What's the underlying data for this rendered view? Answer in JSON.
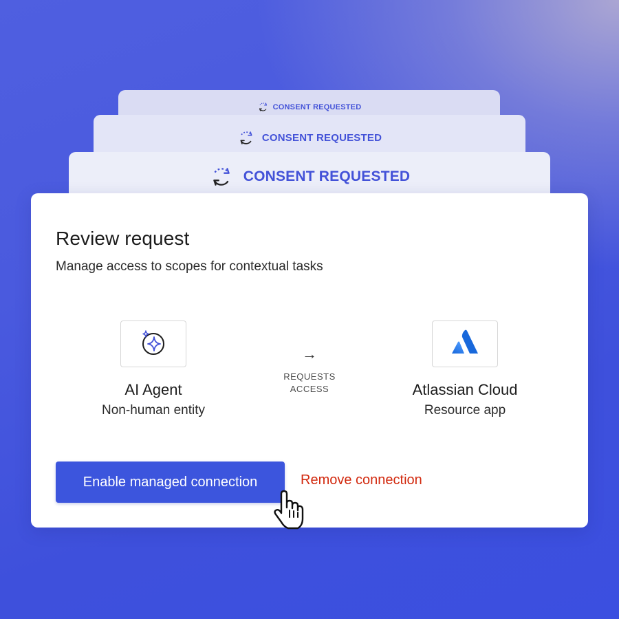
{
  "stack": {
    "back_label": "CONSENT REQUESTED",
    "mid_label": "CONSENT REQUESTED",
    "front_label": "CONSENT REQUESTED",
    "icon": "refresh-cycle-icon"
  },
  "review": {
    "title": "Review request",
    "subtitle": "Manage access to scopes for contextual tasks"
  },
  "agent": {
    "icon": "ai-sparkle-icon",
    "name": "AI Agent",
    "description": "Non-human entity"
  },
  "relation": {
    "arrow": "→",
    "label": "REQUESTS\nACCESS"
  },
  "resource": {
    "icon": "atlassian-logo-icon",
    "name": "Atlassian Cloud",
    "description": "Resource app"
  },
  "actions": {
    "enable_label": "Enable managed connection",
    "remove_label": "Remove connection"
  },
  "colors": {
    "accent": "#3c55dd",
    "danger": "#d2290e",
    "consent_text": "#4352d8",
    "atlassian_blue": "#1868db"
  }
}
